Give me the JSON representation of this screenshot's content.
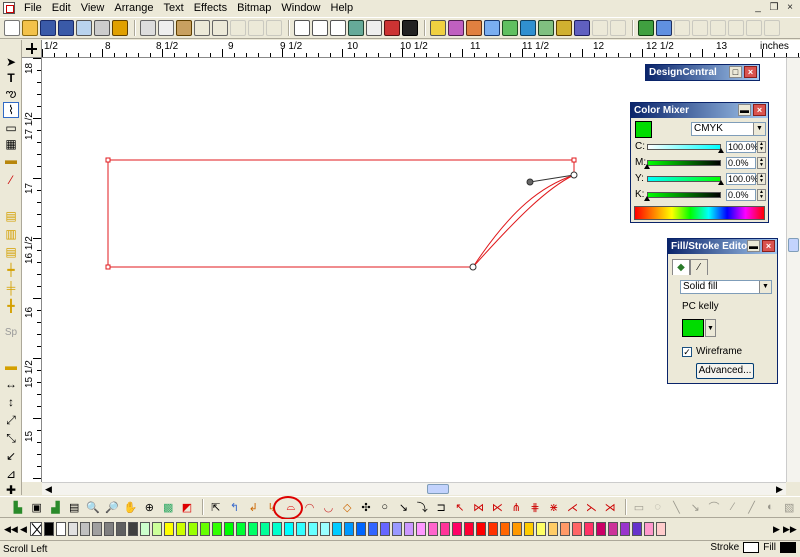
{
  "menu": {
    "items": [
      "File",
      "Edit",
      "View",
      "Arrange",
      "Text",
      "Effects",
      "Bitmap",
      "Window",
      "Help"
    ],
    "window_controls": [
      "_",
      "❐",
      "×"
    ]
  },
  "h_ruler": {
    "labels": [
      "1/2",
      "8",
      "8 1/2",
      "9",
      "9 1/2",
      "10",
      "10 1/2",
      "11",
      "11 1/2",
      "12",
      "12 1/2",
      "13",
      "inches"
    ]
  },
  "v_ruler": {
    "labels": [
      "18",
      "17 1/2",
      "17",
      "16 1/2",
      "16",
      "15 1/2",
      "15"
    ]
  },
  "design_central": {
    "title": "DesignCentral"
  },
  "color_mixer": {
    "title": "Color Mixer",
    "current_color": "#00dc00",
    "model": "CMYK",
    "channels": [
      {
        "label": "C:",
        "value": "100.0%",
        "from": "#ffffff",
        "to": "#00ffff",
        "level": 100
      },
      {
        "label": "M:",
        "value": "0.0%",
        "from": "#00ff00",
        "to": "#000000",
        "level": 0
      },
      {
        "label": "Y:",
        "value": "100.0%",
        "from": "#00ffff",
        "to": "#00ff00",
        "level": 100
      },
      {
        "label": "K:",
        "value": "0.0%",
        "from": "#00ff00",
        "to": "#000000",
        "level": 0
      }
    ]
  },
  "fill_stroke": {
    "title": "Fill/Stroke Editor",
    "fill_type": "Solid fill",
    "color_name": "PC kelly",
    "color": "#00dc00",
    "wireframe_label": "Wireframe",
    "wireframe_checked": true,
    "check_mark": "✓",
    "advanced_label": "Advanced..."
  },
  "status": {
    "left": "Scroll Left",
    "stroke_label": "Stroke",
    "fill_label": "Fill"
  },
  "palette": {
    "colors": [
      "#000000",
      "#ffffff",
      "#e0e0e0",
      "#c0c0c0",
      "#a0a0a0",
      "#808080",
      "#606060",
      "#404040",
      "#ccffcc",
      "#ccff99",
      "#ffff00",
      "#ccff00",
      "#99ff00",
      "#66ff00",
      "#33ff00",
      "#00ff00",
      "#00ff33",
      "#00ff66",
      "#00ff99",
      "#00ffcc",
      "#00ffff",
      "#33ffff",
      "#66ffff",
      "#99ffff",
      "#00ccff",
      "#0099ff",
      "#0066ff",
      "#3366ff",
      "#6666ff",
      "#9999ff",
      "#cc99ff",
      "#ff99ff",
      "#ff66cc",
      "#ff3399",
      "#ff0066",
      "#ff0033",
      "#ff0000",
      "#ff3300",
      "#ff6600",
      "#ff9900",
      "#ffcc00",
      "#ffff66",
      "#ffcc66",
      "#ff9966",
      "#ff6666",
      "#ff3366",
      "#cc0066",
      "#cc3399",
      "#9933cc",
      "#6633cc",
      "#ff99cc",
      "#ffcccc"
    ]
  },
  "canvas_shape": {
    "stroke": "#e0191c"
  }
}
